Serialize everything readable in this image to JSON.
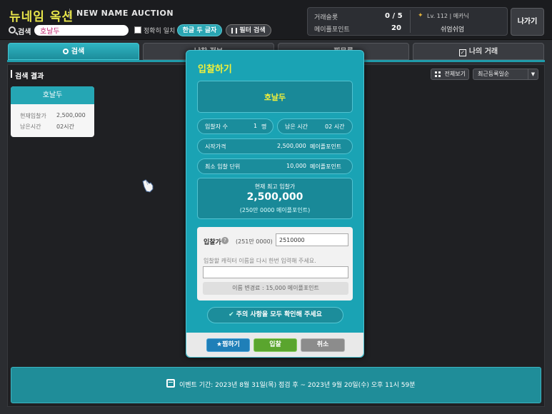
{
  "header": {
    "logo_kr": "뉴네임 옥션",
    "logo_en": "NEW NAME AUCTION",
    "search_label": "검색",
    "search_value": "호날두",
    "exact_match_label": "정확히 일치",
    "korean_only_label": "한글 두 글자",
    "filter_label": "필터 검색",
    "bids_label": "거래슬롯",
    "bids_value": "0 / 5",
    "points_label": "메이플포인트",
    "points_value": "20",
    "level_text": "Lv. 112 | 메카닉",
    "character_name": "쉬엄쉬엄",
    "exit_label": "나가기"
  },
  "tabs": [
    {
      "label": "검색",
      "active": true
    },
    {
      "label": "낙찰 정보",
      "active": false
    },
    {
      "label": "찜목록",
      "active": false
    },
    {
      "label": "나의 거래",
      "active": false
    }
  ],
  "results": {
    "title": "검색 결과",
    "view_all_label": "전체보기",
    "sort_value": "최근등록일순",
    "card": {
      "name": "호날두",
      "current_bid_label": "현재입찰가",
      "current_bid_value": "2,500,000",
      "time_left_label": "남은시간",
      "time_left_value": "02시간"
    }
  },
  "modal": {
    "title": "입찰하기",
    "name": "호날두",
    "bidders_label": "입찰자 수",
    "bidders_value": "1",
    "bidders_unit": "명",
    "time_label": "남은 시간",
    "time_value": "02 시간",
    "start_price_label": "시작가격",
    "start_price_value": "2,500,000",
    "points_unit": "메이플포인트",
    "min_increment_label": "최소 입찰 단위",
    "min_increment_value": "10,000",
    "highest_bid_label": "현재 최고 입찰가",
    "highest_bid_value": "2,500,000",
    "highest_bid_sub": "(250만 0000 메이플포인트)",
    "bid_label": "입찰가",
    "bid_hint": "(251만 0000)",
    "bid_input_value": "2510000",
    "reenter_instruction": "입찰할 캐릭터 이름을 다시 한번 입력해 주세요.",
    "fee_text": "이름 변경료 : 15,000 메이플포인트",
    "confirm_label": "주의 사항을 모두 확인해 주세요",
    "buttons": {
      "favorite": "찜하기",
      "bid": "입찰",
      "cancel": "취소"
    }
  },
  "event": {
    "text": "이벤트 기간: 2023년 8월 31일(목) 점검 후 ~ 2023년 9월 20일(수) 오후 11시 59분"
  }
}
